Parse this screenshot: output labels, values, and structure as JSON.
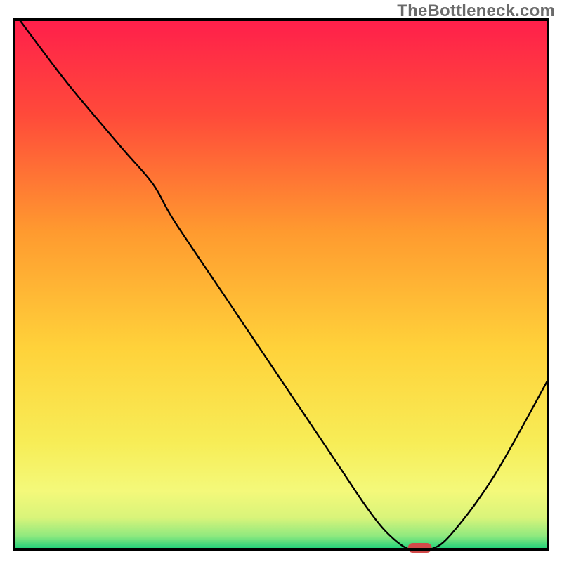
{
  "watermark": "TheBottleneck.com",
  "chart_data": {
    "type": "line",
    "title": "",
    "xlabel": "",
    "ylabel": "",
    "xlim": [
      0,
      100
    ],
    "ylim": [
      0,
      100
    ],
    "notes": "No axis ticks or numeric labels are visible; x and y are normalized percentages of the plot area (0 = left/bottom, 100 = right/top). Values are estimated from the rendered curve.",
    "series": [
      {
        "name": "bottleneck-curve",
        "x": [
          1,
          10,
          20,
          26,
          30,
          40,
          50,
          60,
          66,
          70,
          74,
          78,
          82,
          90,
          100
        ],
        "y": [
          100,
          88,
          76,
          69,
          62,
          47,
          32,
          17,
          8,
          3,
          0,
          0,
          3,
          14,
          32
        ]
      }
    ],
    "markers": [
      {
        "name": "optimal-marker",
        "x": 76,
        "y": 0,
        "shape": "rounded-rect",
        "color": "#d24a4a"
      }
    ],
    "background": {
      "type": "vertical-gradient",
      "stops": [
        {
          "pos": 0.0,
          "color": "#ff1f4b"
        },
        {
          "pos": 0.18,
          "color": "#ff4a3a"
        },
        {
          "pos": 0.4,
          "color": "#ff9a2f"
        },
        {
          "pos": 0.62,
          "color": "#ffd23a"
        },
        {
          "pos": 0.8,
          "color": "#f7ed57"
        },
        {
          "pos": 0.89,
          "color": "#f4f97a"
        },
        {
          "pos": 0.94,
          "color": "#d9f47a"
        },
        {
          "pos": 0.975,
          "color": "#8fe97f"
        },
        {
          "pos": 1.0,
          "color": "#19d07a"
        }
      ]
    },
    "frame_color": "#000000"
  },
  "plot_geometry": {
    "outer_width": 800,
    "outer_height": 800,
    "inner_left": 20,
    "inner_top": 28,
    "inner_width": 760,
    "inner_height": 754
  }
}
